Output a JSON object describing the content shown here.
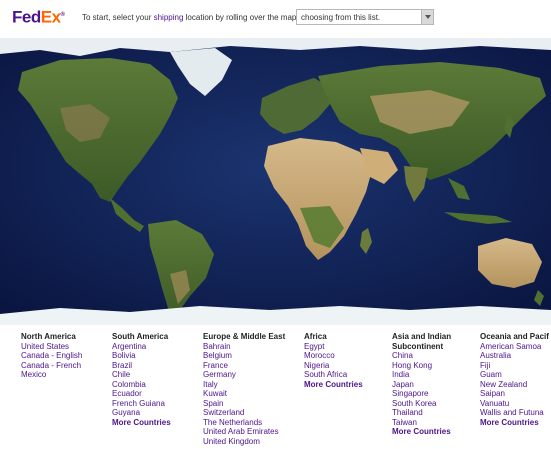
{
  "header": {
    "logo": {
      "fed": "Fed",
      "ex": "Ex",
      "tm": "®"
    },
    "instruction_pre": "To start, select your",
    "instruction_link": "shipping",
    "instruction_post": "location by rolling over the map, or",
    "select_value": "choosing from this list."
  },
  "colors": {
    "brand_purple": "#4d148c",
    "brand_orange": "#ff6600",
    "ocean": "#0d1c4a"
  },
  "regions": [
    {
      "title": "North America",
      "items": [
        "United States",
        "Canada - English",
        "Canada - French",
        "Mexico"
      ],
      "more": ""
    },
    {
      "title": "South America",
      "items": [
        "Argentina",
        "Bolivia",
        "Brazil",
        "Chile",
        "Colombia",
        "Ecuador",
        "French Guiana",
        "Guyana"
      ],
      "more": "More Countries"
    },
    {
      "title": "Europe & Middle East",
      "items": [
        "Bahrain",
        "Belgium",
        "France",
        "Germany",
        "Italy",
        "Kuwait",
        "Spain",
        "Switzerland",
        "The Netherlands",
        "United Arab Emirates",
        "United Kingdom"
      ],
      "more": ""
    },
    {
      "title": "Africa",
      "items": [
        "Egypt",
        "Morocco",
        "Nigeria",
        "South Africa"
      ],
      "more": "More Countries"
    },
    {
      "title": "Asia and Indian",
      "title2": "Subcontinent",
      "items": [
        "China",
        "Hong Kong",
        "India",
        "Japan",
        "Singapore",
        "South Korea",
        "Thailand",
        "Taiwan"
      ],
      "more": "More Countries"
    },
    {
      "title": "Oceania and Pacif",
      "items": [
        "American Samoa",
        "Australia",
        "Fiji",
        "Guam",
        "New Zealand",
        "Saipan",
        "Vanuatu",
        "Wallis and Futuna"
      ],
      "more": "More Countries"
    }
  ]
}
